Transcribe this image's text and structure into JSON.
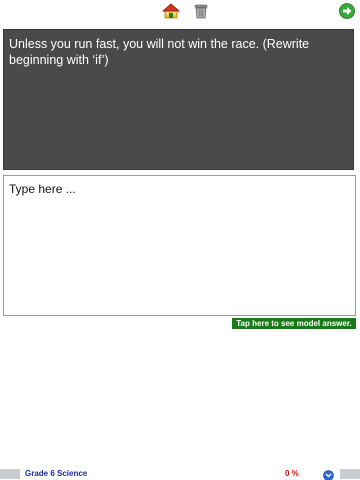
{
  "toolbar": {
    "icons": [
      "home-icon",
      "trash-icon",
      "next-arrow-icon"
    ]
  },
  "question": {
    "text": "Unless you run fast, you will not win the race. (Rewrite beginning with ‘if’)"
  },
  "answer": {
    "placeholder": "Type here ...",
    "value": ""
  },
  "model_answer_button": {
    "label": "Tap here to see model answer."
  },
  "footer": {
    "subject": "Grade 6 Science",
    "progress": "0 %",
    "info_icon": "info-chevron-icon"
  },
  "colors": {
    "question_bg": "#4a4a4a",
    "model_answer_bg": "#1a7a1a",
    "subject_text": "#1a2a9a",
    "progress_text": "#d01010"
  }
}
